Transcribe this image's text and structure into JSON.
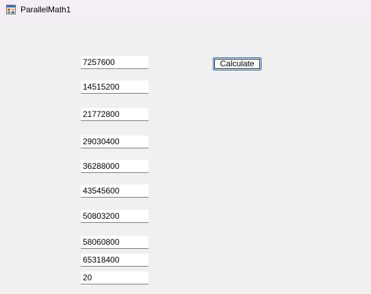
{
  "window": {
    "title": "ParallelMath1",
    "icon": "windows-form-icon"
  },
  "calculate_button": {
    "label": "Calculate"
  },
  "textboxes": [
    {
      "value": "7257600"
    },
    {
      "value": "14515200"
    },
    {
      "value": "21772800"
    },
    {
      "value": "29030400"
    },
    {
      "value": "36288000"
    },
    {
      "value": "43545600"
    },
    {
      "value": "50803200"
    },
    {
      "value": "58060800"
    },
    {
      "value": "65318400"
    },
    {
      "value": "20"
    }
  ]
}
